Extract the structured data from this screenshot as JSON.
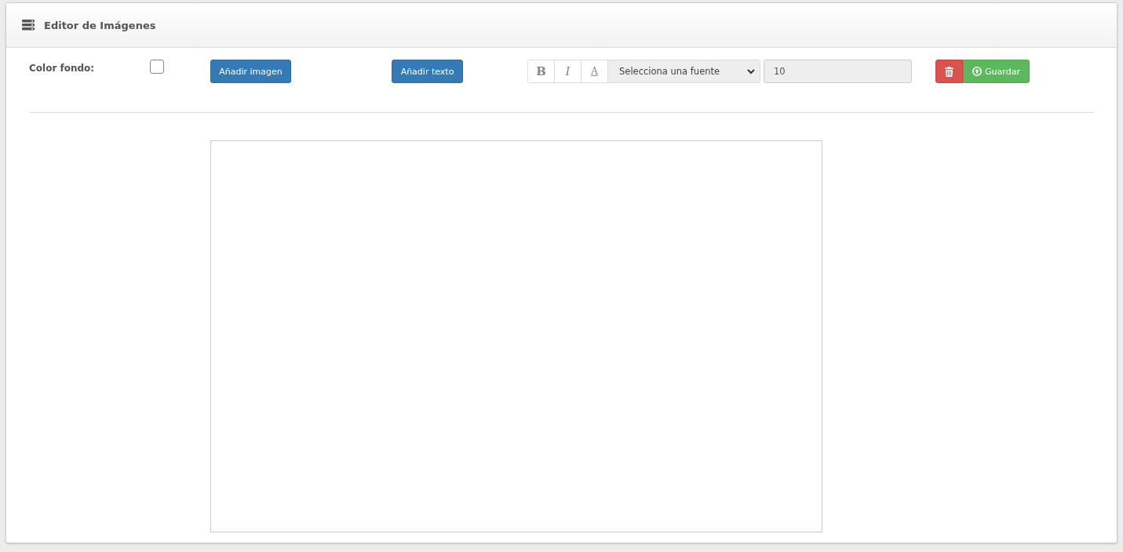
{
  "panel": {
    "title": "Editor de Imágenes"
  },
  "toolbar": {
    "background_label": "Color fondo:",
    "background_checked": false,
    "add_image": "Añadir imagen",
    "add_text": "Añadir texto",
    "format_buttons": [
      {
        "label": "B",
        "kind": "bold",
        "selected": false
      },
      {
        "label": "I",
        "kind": "italic",
        "selected": false
      },
      {
        "label": "A",
        "kind": "underline",
        "selected": false
      }
    ],
    "font_select": "Selecciona una fuente",
    "font_size": "10",
    "save": "Guardar"
  }
}
